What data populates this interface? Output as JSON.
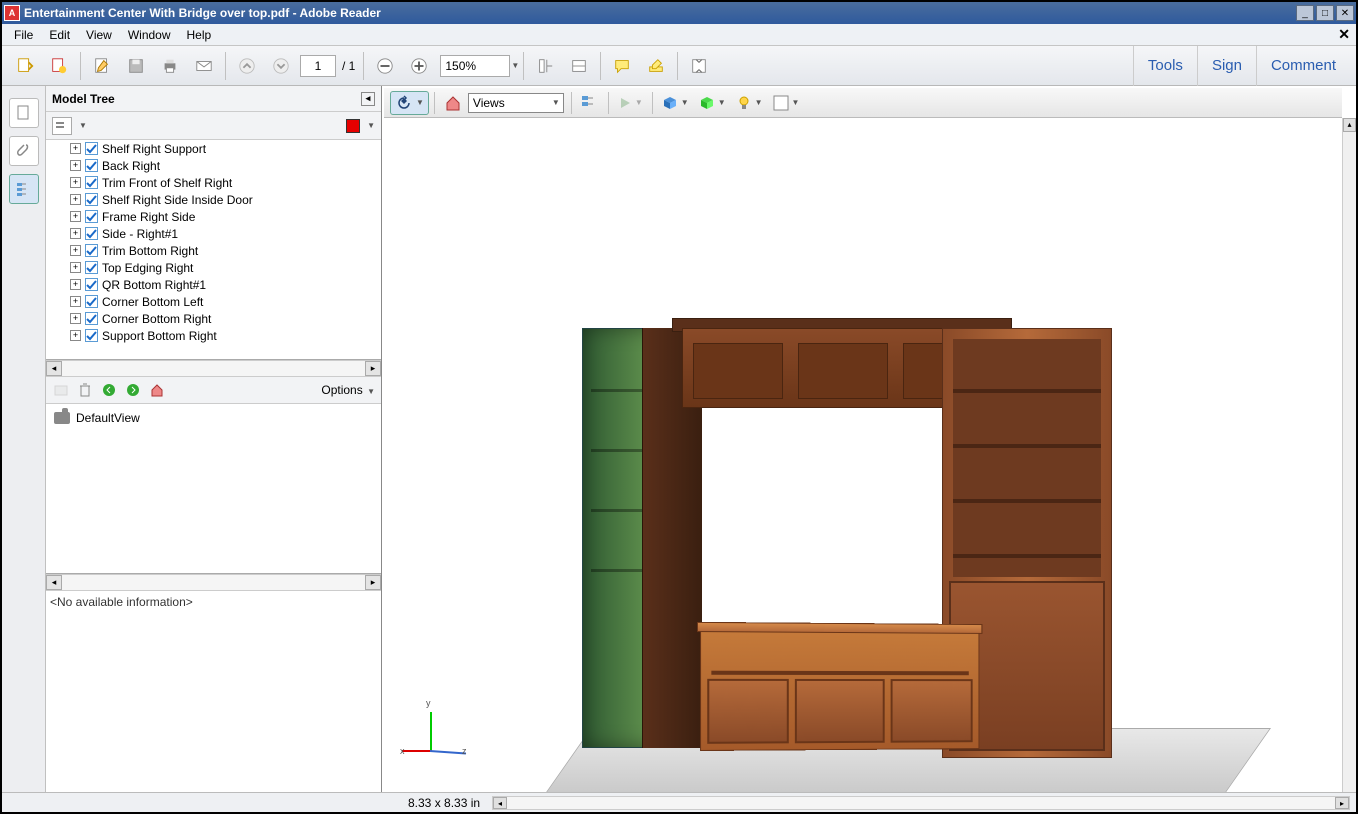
{
  "window": {
    "title": "Entertainment Center With Bridge over top.pdf - Adobe Reader"
  },
  "menubar": {
    "items": [
      "File",
      "Edit",
      "View",
      "Window",
      "Help"
    ]
  },
  "toolbar": {
    "page_current": "1",
    "page_total": "/ 1",
    "zoom": "150%"
  },
  "right_actions": {
    "tools": "Tools",
    "sign": "Sign",
    "comment": "Comment"
  },
  "leftpanel": {
    "title": "Model Tree",
    "highlight_color": "#e60000",
    "tree": [
      "Shelf Right Support",
      "Back Right",
      "Trim Front of Shelf Right",
      "Shelf Right Side Inside Door",
      "Frame Right Side",
      "Side - Right#1",
      "Trim Bottom Right",
      "Top Edging Right",
      "QR Bottom Right#1",
      "Corner Bottom Left",
      "Corner Bottom Right",
      "Support Bottom Right"
    ],
    "views_options": "Options",
    "default_view": "DefaultView",
    "info": "<No available information>"
  },
  "viewer_toolbar": {
    "views_label": "Views"
  },
  "statusbar": {
    "dimensions": "8.33 x 8.33 in"
  },
  "axis": {
    "x": "x",
    "y": "y",
    "z": "z"
  }
}
